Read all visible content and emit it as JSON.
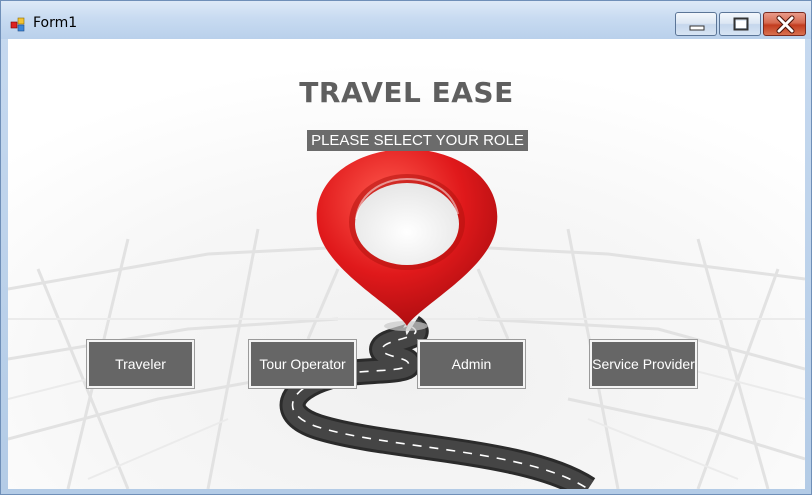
{
  "window": {
    "title": "Form1",
    "icon": "winforms-app-icon",
    "controls": [
      "minimize-icon",
      "maximize-icon",
      "close-icon"
    ]
  },
  "main": {
    "app_title": "TRAVEL EASE",
    "subtitle": "PLEASE SELECT YOUR ROLE",
    "roles": [
      {
        "label": "Traveler"
      },
      {
        "label": "Tour Operator"
      },
      {
        "label": "Admin"
      },
      {
        "label": "Service Provider"
      }
    ]
  },
  "colors": {
    "button_bg": "#666666",
    "title_text": "#5f5f5f",
    "pin_red": "#e0191b"
  }
}
